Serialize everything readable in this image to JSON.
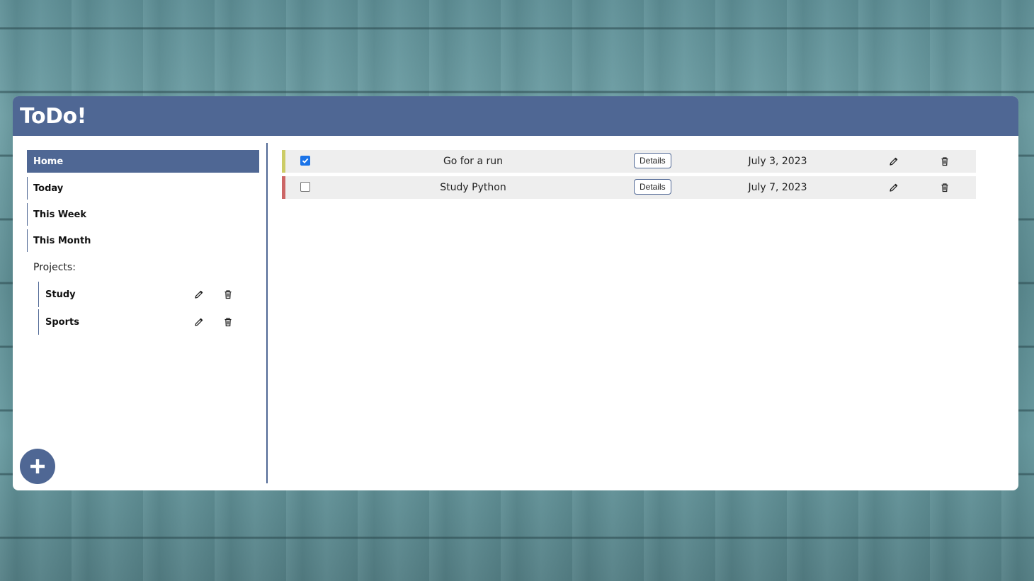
{
  "app": {
    "title": "ToDo!"
  },
  "colors": {
    "primary": "#4f6794",
    "priority_medium": "#cccc66",
    "priority_high": "#cc6666",
    "row_background": "#eeeeee"
  },
  "sidebar": {
    "nav": [
      {
        "label": "Home",
        "active": true
      },
      {
        "label": "Today",
        "active": false
      },
      {
        "label": "This Week",
        "active": false
      },
      {
        "label": "This Month",
        "active": false
      }
    ],
    "projects_label": "Projects:",
    "projects": [
      {
        "name": "Study",
        "edit_icon": "pencil-icon",
        "delete_icon": "trash-icon"
      },
      {
        "name": "Sports",
        "edit_icon": "pencil-icon",
        "delete_icon": "trash-icon"
      }
    ],
    "add_icon": "plus-icon"
  },
  "todos": [
    {
      "title": "Go for a run",
      "done": true,
      "details_label": "Details",
      "date": "July 3, 2023",
      "priority": "medium"
    },
    {
      "title": "Study Python",
      "done": false,
      "details_label": "Details",
      "date": "July 7, 2023",
      "priority": "high"
    }
  ]
}
